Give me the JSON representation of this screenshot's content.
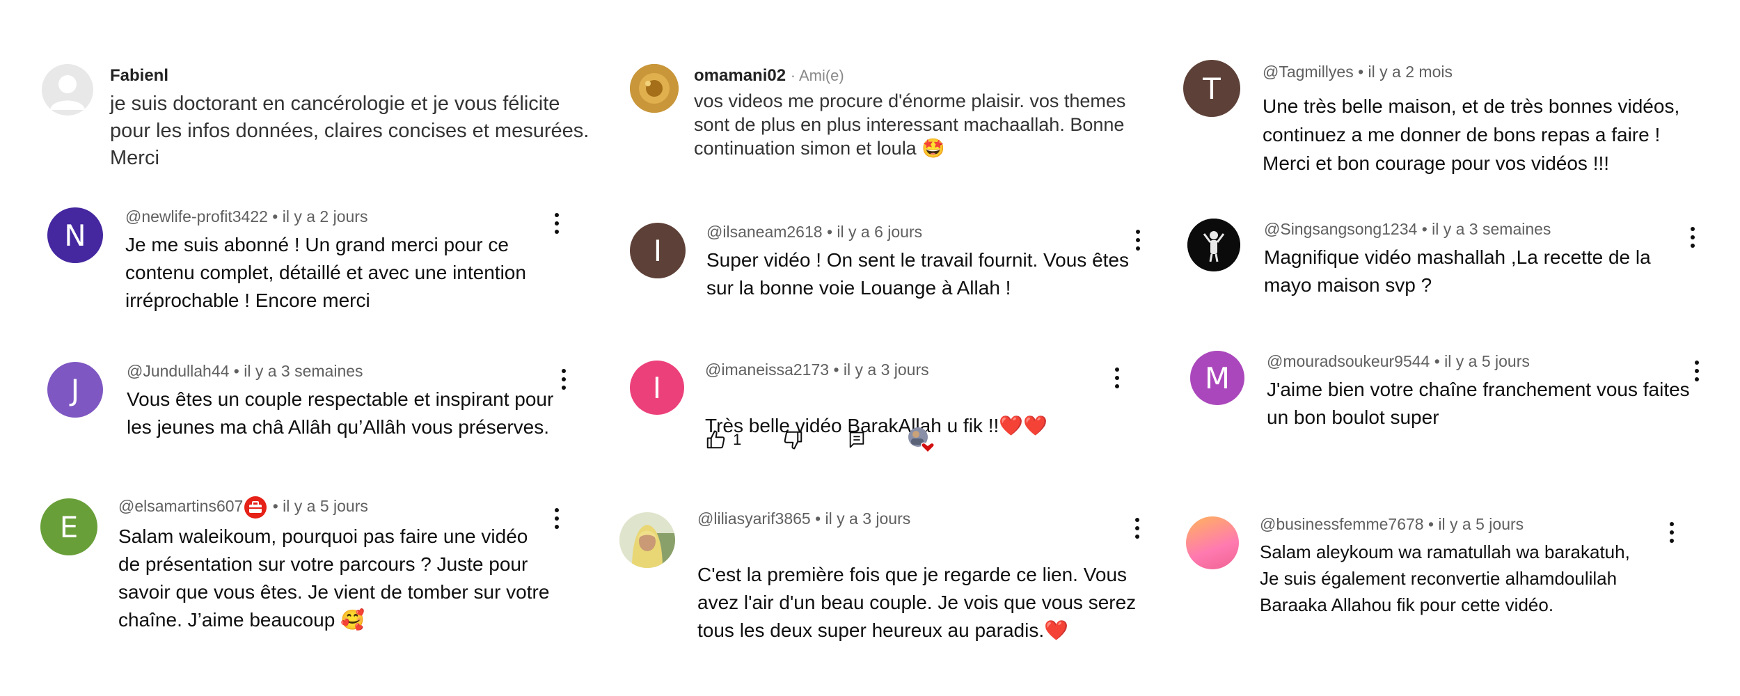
{
  "colors": {
    "avatar_N": "#4527a0",
    "avatar_J": "#7e57c2",
    "avatar_E": "#689f38",
    "avatar_T": "#5d4037",
    "avatar_I1": "#5d4037",
    "avatar_I2": "#ec407a",
    "avatar_M": "#ab47bc",
    "heart": "#d20f0f",
    "badge": "#e62117"
  },
  "comments": {
    "c1": {
      "author": "Fabienl",
      "text": "je suis doctorant en cancérologie et je vous félicite pour les infos données, claires concises et mesurées. Merci"
    },
    "c2": {
      "author": "omamani02",
      "friend": "· Ami(e)",
      "text": "vos videos me procure d'énorme plaisir. vos themes sont de plus en plus interessant machaallah. Bonne continuation simon et loula 🤩"
    },
    "c3": {
      "initial": "T",
      "author": "@Tagmillyes",
      "time": "• il y a 2 mois",
      "text": "Une très belle maison, et de très bonnes vidéos,\ncontinuez a me donner de bons repas a faire !\nMerci et bon courage pour vos vidéos !!!"
    },
    "c4": {
      "initial": "N",
      "author": "@newlife-profit3422",
      "time": "• il y a 2 jours",
      "text": "Je me suis abonné ! Un grand merci pour ce\ncontenu complet, détaillé et avec une intention\nirréprochable ! Encore merci"
    },
    "c5": {
      "initial": "I",
      "author": "@ilsaneam2618",
      "time": "• il y a 6 jours",
      "text": "Super vidéo ! On sent le travail fournit. Vous êtes\nsur la bonne voie Louange à Allah !"
    },
    "c6": {
      "author": "@Singsangsong1234",
      "time": "• il y a 3 semaines",
      "text": "Magnifique vidéo mashallah ,La recette de la\nmayo maison svp ?"
    },
    "c7": {
      "initial": "J",
      "author": "@Jundullah44",
      "time": "• il y a 3 semaines",
      "text": "Vous êtes un couple respectable et inspirant pour\nles jeunes ma châ Allâh qu’Allâh vous préserves."
    },
    "c8": {
      "initial": "I",
      "author": "@imaneissa2173",
      "time": "• il y a 3 jours",
      "text": "Très belle vidéo BarakAllah u fik !!",
      "hearts": "❤️❤️",
      "like_count": "1"
    },
    "c9": {
      "initial": "M",
      "author": "@mouradsoukeur9544",
      "time": "• il y a 5 jours",
      "text": "J'aime bien votre chaîne franchement vous faites\nun bon boulot super"
    },
    "c10": {
      "initial": "E",
      "author": "@elsamartins607",
      "time": "• il y a 5 jours",
      "text": "Salam waleikoum, pourquoi pas faire une vidéo\nde présentation sur votre parcours ? Juste pour\nsavoir que vous êtes. Je vient de tomber sur votre\nchaîne. J’aime beaucoup 🥰"
    },
    "c11": {
      "author": "@liliasyarif3865",
      "time": "• il y a 3 jours",
      "text": "C'est la première fois que je regarde ce lien. Vous\navez l'air d'un beau couple. Je vois que vous serez\ntous les deux super heureux au paradis.",
      "heart": "❤️"
    },
    "c12": {
      "author": "@businessfemme7678",
      "time": "• il y a 5 jours",
      "text": "Salam aleykoum wa ramatullah wa barakatuh,\nJe suis également reconvertie alhamdoulilah\nBaraaka Allahou fik pour cette vidéo."
    }
  }
}
